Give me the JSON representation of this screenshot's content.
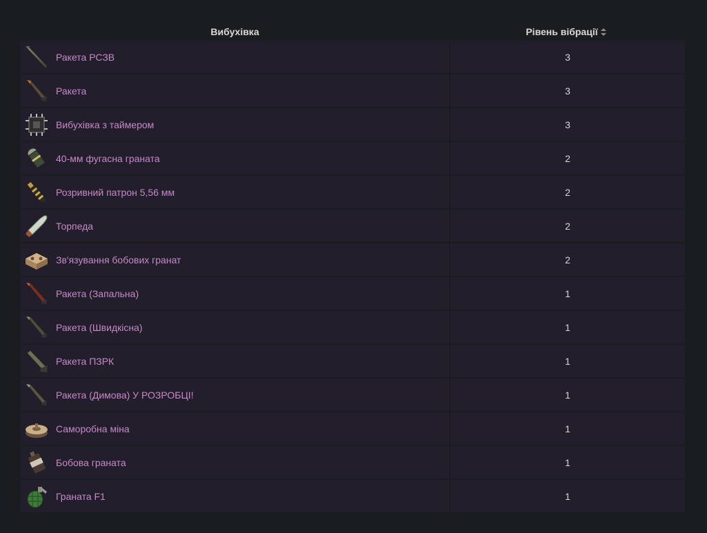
{
  "table": {
    "headers": {
      "name": "Вибухівка",
      "level": "Рівень вібрації"
    },
    "rows": [
      {
        "name": "Ракета РСЗВ",
        "level": "3",
        "icon": "mlrs-rocket-icon"
      },
      {
        "name": "Ракета",
        "level": "3",
        "icon": "rocket-icon"
      },
      {
        "name": "Вибухівка з таймером",
        "level": "3",
        "icon": "timed-explosive-icon"
      },
      {
        "name": "40-мм фугасна граната",
        "level": "2",
        "icon": "he-grenade-40mm-icon"
      },
      {
        "name": "Розривний патрон 5,56 мм",
        "level": "2",
        "icon": "explosive-ammo-556-icon"
      },
      {
        "name": "Торпеда",
        "level": "2",
        "icon": "torpedo-icon"
      },
      {
        "name": "Зв'язування бобових гранат",
        "level": "2",
        "icon": "satchel-charge-icon"
      },
      {
        "name": "Ракета (Запальна)",
        "level": "1",
        "icon": "incendiary-rocket-icon"
      },
      {
        "name": "Ракета (Швидкісна)",
        "level": "1",
        "icon": "hv-rocket-icon"
      },
      {
        "name": "Ракета ПЗРК",
        "level": "1",
        "icon": "sam-rocket-icon"
      },
      {
        "name": "Ракета (Димова) У РОЗРОБЦІ!",
        "level": "1",
        "icon": "smoke-rocket-icon"
      },
      {
        "name": "Саморобна міна",
        "level": "1",
        "icon": "landmine-icon"
      },
      {
        "name": "Бобова граната",
        "level": "1",
        "icon": "beancan-grenade-icon"
      },
      {
        "name": "Граната F1",
        "level": "1",
        "icon": "f1-grenade-icon"
      }
    ]
  }
}
